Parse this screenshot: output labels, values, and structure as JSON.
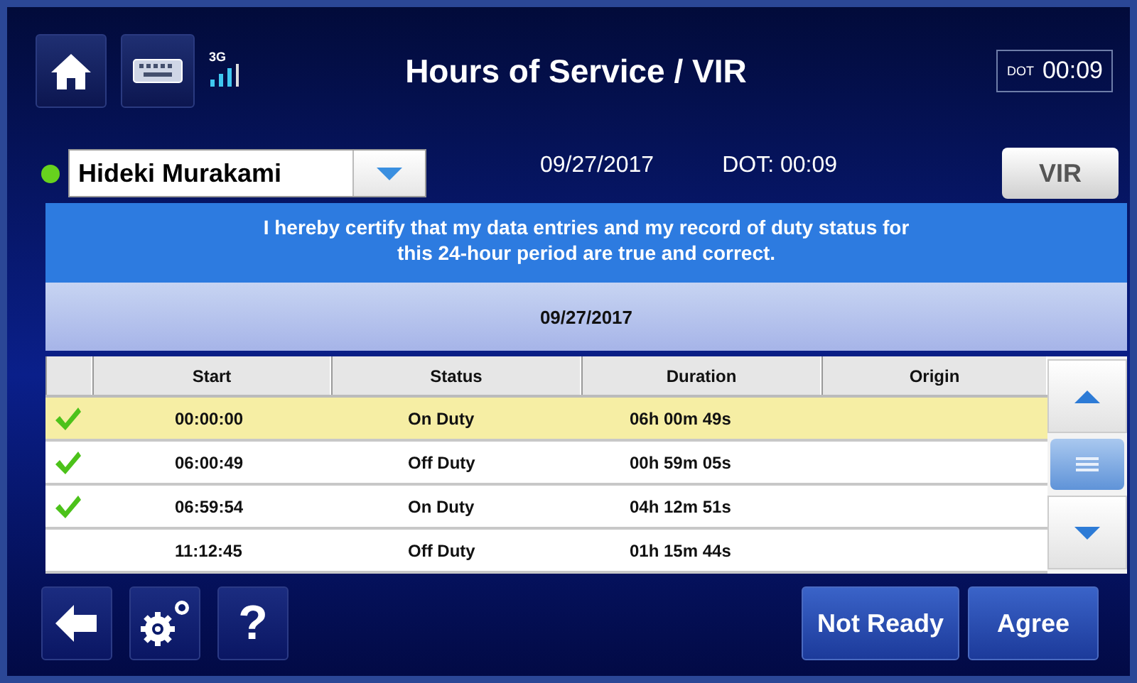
{
  "header": {
    "title": "Hours of Service / VIR",
    "network": "3G",
    "dot_clock": {
      "label": "DOT",
      "time": "00:09"
    }
  },
  "driver": {
    "name": "Hideki Murakami",
    "online": true,
    "date": "09/27/2017",
    "dot": "DOT: 00:09",
    "vir_button": "VIR"
  },
  "certification": "I hereby certify that my data entries and my record of duty status for this 24-hour period are true and correct.",
  "log_date": "09/27/2017",
  "table": {
    "columns": [
      "Start",
      "Status",
      "Duration",
      "Origin"
    ],
    "rows": [
      {
        "checked": true,
        "selected": true,
        "start": "00:00:00",
        "status": "On Duty",
        "duration": "06h 00m 49s"
      },
      {
        "checked": true,
        "selected": false,
        "start": "06:00:49",
        "status": "Off Duty",
        "duration": "00h 59m 05s"
      },
      {
        "checked": true,
        "selected": false,
        "start": "06:59:54",
        "status": "On Duty",
        "duration": "04h 12m 51s"
      },
      {
        "checked": false,
        "selected": false,
        "start": "11:12:45",
        "status": "Off Duty",
        "duration": "01h 15m 44s"
      }
    ]
  },
  "footer": {
    "help": "?",
    "buttons": [
      "Not Ready",
      "Agree"
    ]
  }
}
